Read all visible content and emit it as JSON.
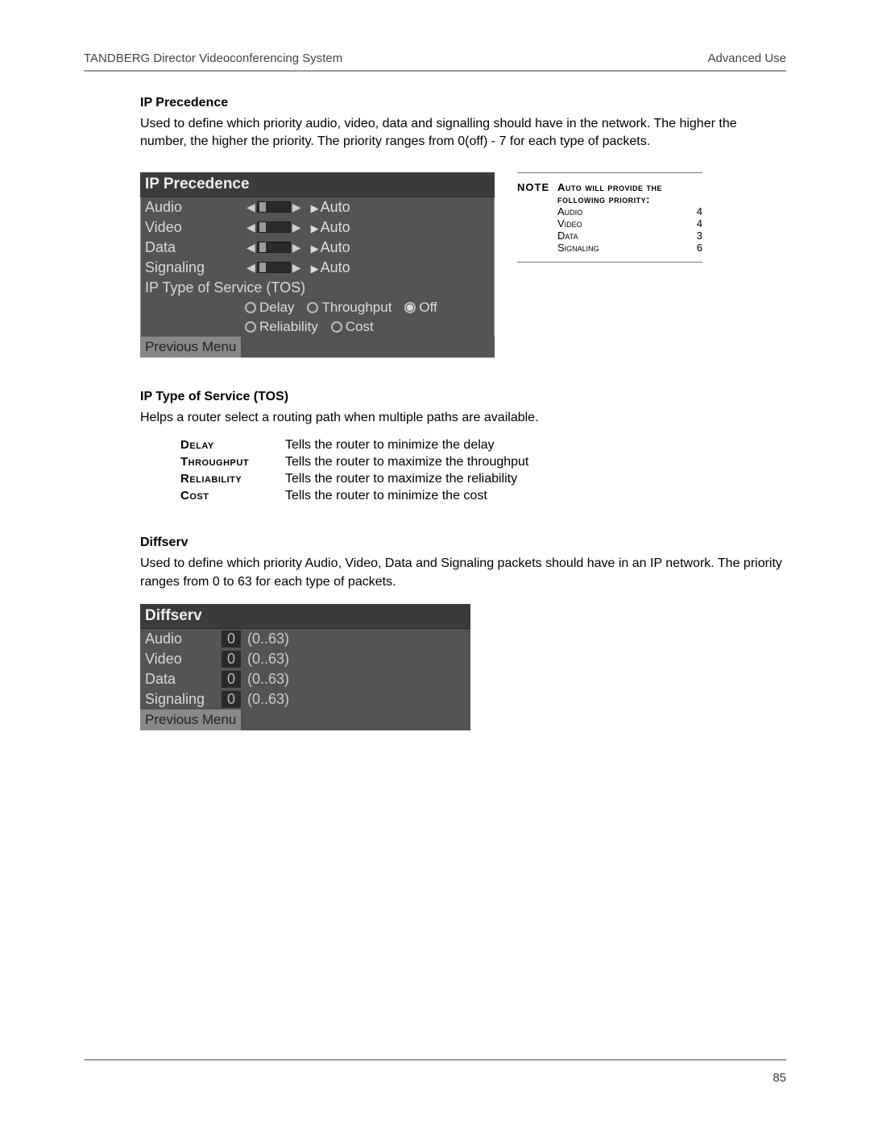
{
  "header": {
    "left": "TANDBERG Director Videoconferencing System",
    "right": "Advanced Use"
  },
  "ip_precedence": {
    "title": "IP Precedence",
    "body": "Used to define which priority audio, video, data and signalling should have in the network. The higher the number, the higher the priority. The priority ranges from 0(off) - 7 for each type of packets.",
    "menu": {
      "title": "IP Precedence",
      "rows": [
        {
          "label": "Audio",
          "value": "Auto"
        },
        {
          "label": "Video",
          "value": "Auto"
        },
        {
          "label": "Data",
          "value": "Auto"
        },
        {
          "label": "Signaling",
          "value": "Auto"
        }
      ],
      "sub_title": "IP Type of Service (TOS)",
      "tos_options": [
        {
          "label": "Delay",
          "selected": false
        },
        {
          "label": "Throughput",
          "selected": false
        },
        {
          "label": "Off",
          "selected": true
        },
        {
          "label": "Reliability",
          "selected": false
        },
        {
          "label": "Cost",
          "selected": false
        }
      ],
      "prev": "Previous Menu"
    },
    "note": {
      "label": "NOTE",
      "header": "Auto will provide the following priority:",
      "entries": [
        {
          "name": "Audio",
          "val": "4"
        },
        {
          "name": "Video",
          "val": "4"
        },
        {
          "name": "Data",
          "val": "3"
        },
        {
          "name": "Signaling",
          "val": "6"
        }
      ]
    }
  },
  "tos": {
    "title": "IP Type of Service (TOS)",
    "body": "Helps a router select a routing path when multiple paths are available.",
    "defs": [
      {
        "k": "Delay",
        "v": "Tells the router to minimize the delay"
      },
      {
        "k": "Throughput",
        "v": "Tells the router to maximize the throughput"
      },
      {
        "k": "Reliability",
        "v": "Tells the router to maximize the reliability"
      },
      {
        "k": "Cost",
        "v": "Tells the router to minimize the cost"
      }
    ]
  },
  "diffserv": {
    "title": "Diffserv",
    "body": "Used to define which priority Audio, Video, Data and Signaling packets should have in an IP network. The priority ranges from 0 to 63 for each type of packets.",
    "menu": {
      "title": "Diffserv",
      "rows": [
        {
          "label": "Audio",
          "value": "0",
          "range": "(0..63)"
        },
        {
          "label": "Video",
          "value": "0",
          "range": "(0..63)"
        },
        {
          "label": "Data",
          "value": "0",
          "range": "(0..63)"
        },
        {
          "label": "Signaling",
          "value": "0",
          "range": "(0..63)"
        }
      ],
      "prev": "Previous Menu"
    }
  },
  "page_number": "85"
}
